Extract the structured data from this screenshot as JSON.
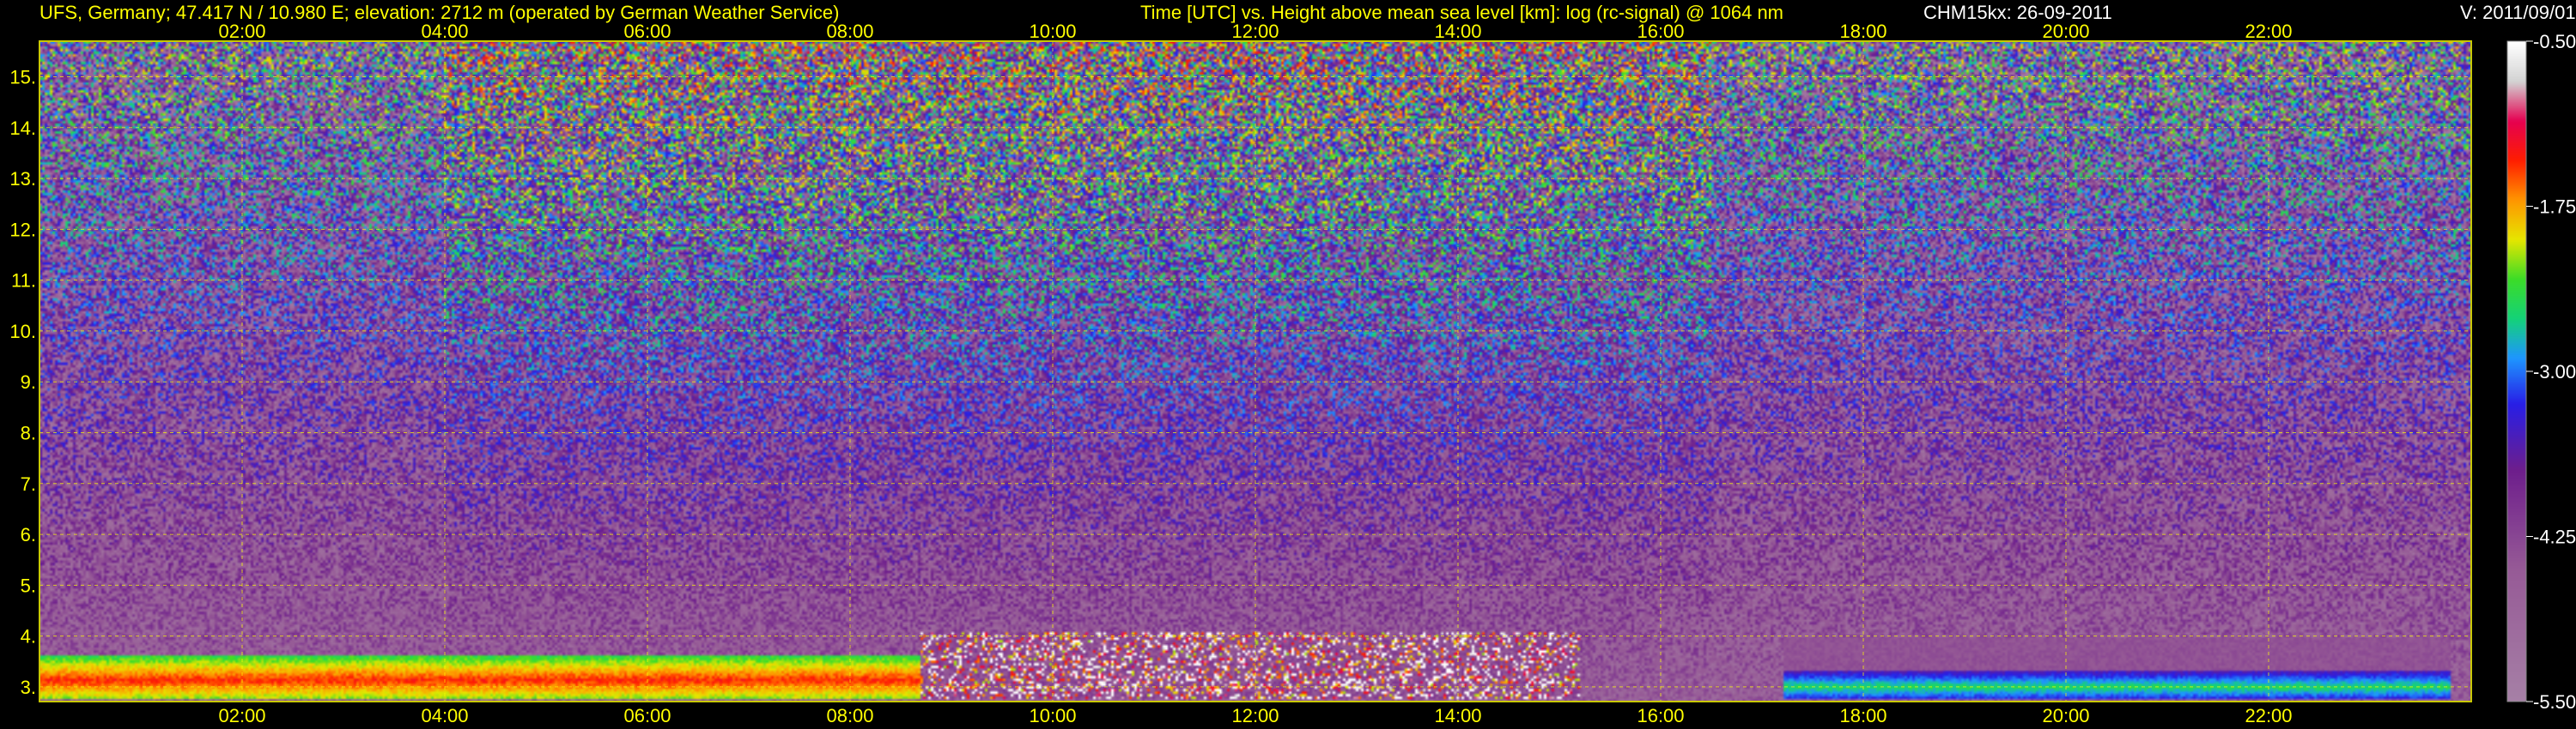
{
  "header": {
    "site": "UFS, Germany; 47.417 N / 10.980 E; elevation: 2712 m  (operated by German Weather Service)",
    "title": "Time [UTC] vs. Height above mean sea level [km]: log (rc-signal) @ 1064 nm",
    "instrument": "CHM15kx: 26-09-2011",
    "version": "V: 2011/09/01"
  },
  "colors": {
    "axis_text": "#ffff00",
    "grid": "#ffff00",
    "frame": "#c8c800",
    "colorbar_text": "#ffffff"
  },
  "chart_data": {
    "type": "heatmap",
    "title": "Time [UTC] vs. Height above mean sea level [km]: log (rc-signal) @ 1064 nm",
    "xlabel": "Time [UTC]",
    "ylabel": "Height above mean sea level [km]",
    "x_ticks": [
      "02:00",
      "04:00",
      "06:00",
      "08:00",
      "10:00",
      "12:00",
      "14:00",
      "16:00",
      "18:00",
      "20:00",
      "22:00"
    ],
    "x_tick_hours": [
      2,
      4,
      6,
      8,
      10,
      12,
      14,
      16,
      18,
      20,
      22
    ],
    "xlim_hours": [
      0,
      24
    ],
    "y_ticks": [
      "3.",
      "4.",
      "5.",
      "6.",
      "7.",
      "8.",
      "9.",
      "10.",
      "11.",
      "12.",
      "13.",
      "14.",
      "15."
    ],
    "y_tick_values": [
      3,
      4,
      5,
      6,
      7,
      8,
      9,
      10,
      11,
      12,
      13,
      14,
      15
    ],
    "ylim_km": [
      2.712,
      15.7
    ],
    "grid": true,
    "colorbar": {
      "ticks": [
        "-0.50",
        "-1.75",
        "-3.00",
        "-4.25",
        "-5.50"
      ],
      "tick_values": [
        -0.5,
        -1.75,
        -3.0,
        -4.25,
        -5.5
      ],
      "range": [
        -5.5,
        -0.5
      ]
    },
    "features": [
      {
        "kind": "boundary_layer",
        "t_start": 0.0,
        "t_end": 8.7,
        "h_low": 2.75,
        "h_high": 3.6,
        "level": -1.4
      },
      {
        "kind": "cloud_spikes",
        "t_start": 8.7,
        "t_end": 15.2,
        "h_low": 2.75,
        "h_high": 4.1,
        "level": -0.9
      },
      {
        "kind": "lower_layer",
        "t_start": 17.2,
        "t_end": 23.8,
        "h_low": 2.75,
        "h_high": 3.3,
        "level": -2.5
      },
      {
        "kind": "haze_layer",
        "t_start": 17.2,
        "t_end": 23.8,
        "h_low": 3.3,
        "h_high": 4.0,
        "level": -4.4
      }
    ]
  }
}
